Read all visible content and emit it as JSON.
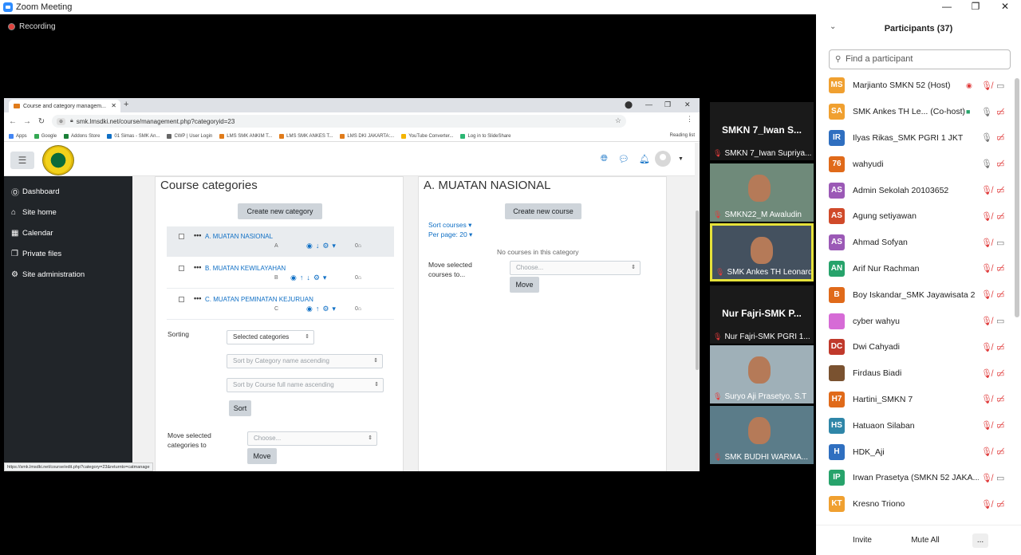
{
  "window": {
    "title": "Zoom Meeting",
    "minimize": "—",
    "restore": "❐",
    "close": "✕",
    "recording": "Recording"
  },
  "browser": {
    "tab_title": "Course and category managem...",
    "url_zoom": "⊕",
    "url": "smk.lmsdki.net/course/management.php?categoryid=23",
    "bookmarks": [
      "Apps",
      "Google",
      "Addons Store",
      "01 Simas - SMK An...",
      "CWP | User Login",
      "LMS SMK ANKIM T...",
      "LMS SMK ANKES T...",
      "LMS DKI JAKARTA:...",
      "YouTube Converter...",
      "Log in to SlideShare"
    ],
    "bookmark_colors": [
      "#4285f4",
      "#34a853",
      "#1a7f37",
      "#0f6fc5",
      "#666666",
      "#e07b1a",
      "#e07b1a",
      "#e07b1a",
      "#f4b400",
      "#2bb673"
    ],
    "reading_list": "Reading list",
    "status_url": "https://smk.lmsdki.net/course/edit.php?category=23&returnto=catmanage"
  },
  "sidebar": {
    "items": [
      {
        "icon": "Ⓞ",
        "label": "Dashboard"
      },
      {
        "icon": "⌂",
        "label": "Site home"
      },
      {
        "icon": "▦",
        "label": "Calendar"
      },
      {
        "icon": "❐",
        "label": "Private files"
      },
      {
        "icon": "⚙",
        "label": "Site administration"
      }
    ]
  },
  "categories": {
    "title": "Course categories",
    "create_btn": "Create new category",
    "rows": [
      {
        "name": "A. MUATAN NASIONAL",
        "id": "A",
        "actions": "◉↓⚙▾",
        "count": "0⌂"
      },
      {
        "name": "B. MUATAN KEWILAYAHAN",
        "id": "B",
        "actions": "◉↑↓⚙▾",
        "count": "0⌂"
      },
      {
        "name": "C. MUATAN PEMINATAN KEJURUAN",
        "id": "C",
        "actions": "◉↑⚙▾",
        "count": "0⌂"
      }
    ],
    "sorting_label": "Sorting",
    "sort_select": "Selected categories",
    "sort_cat": "Sort by Category name ascending",
    "sort_course": "Sort by Course full name ascending",
    "sort_btn": "Sort",
    "move_label": "Move selected categories to",
    "move_select": "Choose...",
    "move_btn": "Move"
  },
  "courses": {
    "title": "A. MUATAN NASIONAL",
    "create_btn": "Create new course",
    "sort_link": "Sort courses",
    "per_page": "Per page: 20",
    "empty": "No courses in this category",
    "move_label": "Move selected courses to...",
    "move_select": "Choose...",
    "move_btn": "Move"
  },
  "videos": [
    {
      "big": "SMKN 7_Iwan S...",
      "name": "SMKN 7_Iwan Supriya..."
    },
    {
      "big": "",
      "name": "SMKN22_M Awaludin"
    },
    {
      "big": "",
      "name": "SMK Ankes TH Leonardo"
    },
    {
      "big": "Nur Fajri-SMK P...",
      "name": "Nur Fajri-SMK PGRI 1..."
    },
    {
      "big": "",
      "name": "Suryo Aji Prasetyo, S.T"
    },
    {
      "big": "",
      "name": "SMK BUDHI WARMA..."
    }
  ],
  "participants": {
    "title": "Participants (37)",
    "search_placeholder": "Find a participant",
    "list": [
      {
        "initials": "MS",
        "color": "#f0a030",
        "name": "Marjianto SMKN 52 (Host)",
        "extra": "◉",
        "mic": "muted",
        "cam": "on"
      },
      {
        "initials": "SA",
        "color": "#f0a030",
        "name": "SMK Ankes TH Le... (Co-host)",
        "extra": "■",
        "mic": "on",
        "cam": "off"
      },
      {
        "initials": "IR",
        "color": "#2f6fc0",
        "name": "Ilyas Rikas_SMK PGRI 1 JKT",
        "extra": "",
        "mic": "on",
        "cam": "off"
      },
      {
        "initials": "76",
        "color": "#e06a1a",
        "name": "wahyudi",
        "extra": "",
        "mic": "on",
        "cam": "off"
      },
      {
        "initials": "AS",
        "color": "#9b59b6",
        "name": "Admin Sekolah 20103652",
        "extra": "",
        "mic": "muted",
        "cam": "off"
      },
      {
        "initials": "AS",
        "color": "#d04a2a",
        "name": "Agung setiyawan",
        "extra": "",
        "mic": "muted",
        "cam": "off"
      },
      {
        "initials": "AS",
        "color": "#9b59b6",
        "name": "Ahmad Sofyan",
        "extra": "",
        "mic": "muted",
        "cam": "on"
      },
      {
        "initials": "AN",
        "color": "#27a36b",
        "name": "Arif Nur Rachman",
        "extra": "",
        "mic": "muted",
        "cam": "off"
      },
      {
        "initials": "B",
        "color": "#e06a1a",
        "name": "Boy Iskandar_SMK Jayawisata 2",
        "extra": "",
        "mic": "muted",
        "cam": "off"
      },
      {
        "initials": "",
        "color": "#d66bd6",
        "name": "cyber wahyu",
        "extra": "",
        "mic": "muted",
        "cam": "on"
      },
      {
        "initials": "DC",
        "color": "#c0392b",
        "name": "Dwi Cahyadi",
        "extra": "",
        "mic": "muted",
        "cam": "off"
      },
      {
        "initials": "",
        "color": "#7a5230",
        "name": "Firdaus Biadi",
        "extra": "",
        "mic": "muted",
        "cam": "off"
      },
      {
        "initials": "H7",
        "color": "#e06a1a",
        "name": "Hartini_SMKN 7",
        "extra": "",
        "mic": "muted",
        "cam": "off"
      },
      {
        "initials": "HS",
        "color": "#2f86a8",
        "name": "Hatuaon Silaban",
        "extra": "",
        "mic": "muted",
        "cam": "off"
      },
      {
        "initials": "H",
        "color": "#2f6fc0",
        "name": "HDK_Aji",
        "extra": "",
        "mic": "muted",
        "cam": "off"
      },
      {
        "initials": "IP",
        "color": "#27a36b",
        "name": "Irwan Prasetya (SMKN 52 JAKA...",
        "extra": "",
        "mic": "muted",
        "cam": "on"
      },
      {
        "initials": "KT",
        "color": "#f0a030",
        "name": "Kresno Triono",
        "extra": "",
        "mic": "muted",
        "cam": "off"
      }
    ],
    "invite": "Invite",
    "mute_all": "Mute All",
    "more": "..."
  }
}
